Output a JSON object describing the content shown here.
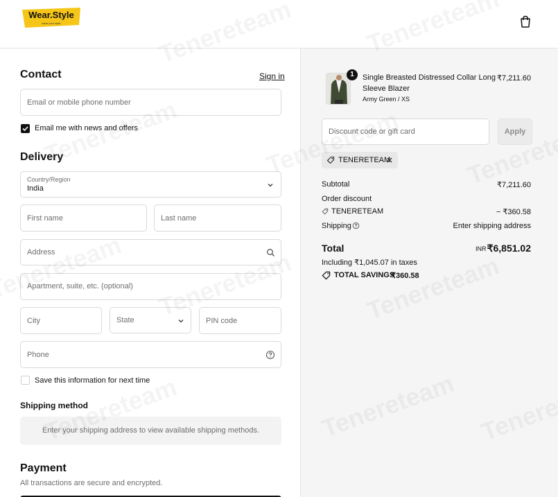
{
  "header": {
    "logo_text": "Wear.Style",
    "logo_tagline": "wear your style"
  },
  "contact": {
    "title": "Contact",
    "sign_in": "Sign in",
    "email_placeholder": "Email or mobile phone number",
    "newsletter_label": "Email me with news and offers"
  },
  "delivery": {
    "title": "Delivery",
    "country_label": "Country/Region",
    "country_value": "India",
    "first_name": "First name",
    "last_name": "Last name",
    "address": "Address",
    "apartment": "Apartment, suite, etc. (optional)",
    "city": "City",
    "state": "State",
    "pin": "PIN code",
    "phone": "Phone",
    "save_info": "Save this information for next time"
  },
  "shipping": {
    "title": "Shipping method",
    "message": "Enter your shipping address to view available shipping methods."
  },
  "payment": {
    "title": "Payment",
    "subtitle": "All transactions are secure and encrypted."
  },
  "order": {
    "qty_badge": "1",
    "product_name_line1": "Single Breasted Distressed Collar Long",
    "product_name_line2": "Sleeve Blazer",
    "variant": "Army Green / XS",
    "price": "₹7,211.60",
    "discount_placeholder": "Discount code or gift card",
    "apply": "Apply",
    "code_tag": "TENERETEAM",
    "subtotal_label": "Subtotal",
    "subtotal_value": "₹7,211.60",
    "order_discount_label": "Order discount",
    "discount_code": "TENERETEAM",
    "discount_value": "− ₹360.58",
    "shipping_label": "Shipping",
    "shipping_value": "Enter shipping address",
    "total_label": "Total",
    "currency": "INR",
    "total_value": "₹6,851.02",
    "taxes": "Including ₹1,045.07 in taxes",
    "savings_label": "TOTAL SAVINGS",
    "savings_value": "₹360.58"
  },
  "watermark": "Tenereteam",
  "colors": {
    "logo_bg": "#f5c518",
    "accent": "#111111",
    "panel_bg": "#f5f5f5"
  }
}
